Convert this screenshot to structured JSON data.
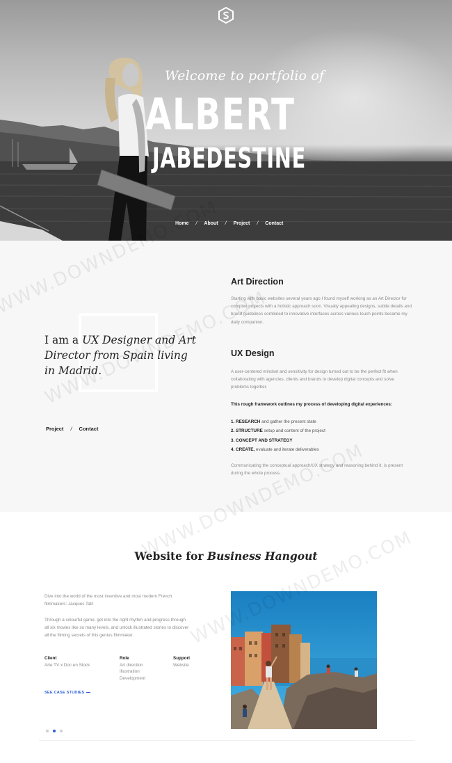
{
  "hero": {
    "logo_icon": "hexagon-s-logo-icon",
    "welcome": "Welcome to portfolio of",
    "first_name": "ALBERT",
    "last_name": "JABEDESTINE",
    "nav": [
      "Home",
      "About",
      "Project",
      "Contact"
    ],
    "nav_separator": "/"
  },
  "about": {
    "tagline_plain": "I am a",
    "tagline_italic": "UX Designer and Art Director from Spain living in Madrid.",
    "links": [
      "Project",
      "Contact"
    ],
    "links_separator": "/",
    "art_direction": {
      "title": "Art Direction",
      "text": "Starting with basic websites several years ago I found myself working as an Art Director for complex projects with a holistic approach soon. Visually appealing designs, subtle details and brand guidelines combined to innovative interfaces across various touch points became my daily companion."
    },
    "ux_design": {
      "title": "UX Design",
      "text": "A user-centered mindset and sensitivity for design turned out to be the perfect fit when collaborating with agencies, clients and brands to develop digital concepts and solve problems together.",
      "framework_intro": "This rough framework outlines my process of developing digital experiences:",
      "steps": [
        {
          "num": "1.",
          "bold": "RESEARCH",
          "rest": " and gather the present state"
        },
        {
          "num": "2.",
          "bold": "STRUCTURE",
          "rest": " setup and content of the project"
        },
        {
          "num": "3.",
          "bold": "CONCEPT AND STRATEGY",
          "rest": ""
        },
        {
          "num": "4.",
          "bold": "CREATE,",
          "rest": " evaluate and iterate deliverables"
        }
      ],
      "closing": "Communicating the conceptual approach/UX strategy and reasoning behind it, is present during the whole process."
    }
  },
  "project": {
    "title_plain": "Website for",
    "title_italic": "Business Hangout",
    "desc1": "Dive into the world of the most inventive and most modern French filmmakers: Jacques Tati!",
    "desc2": "Through a colourful game, get into the right rhythm and progress through all six movies like so many levels, and unlock illustrated stories to discover all the filming secrets of this genius filmmaker.",
    "client": {
      "label": "Client",
      "lines": [
        "Arte TV x Doc en Stock"
      ]
    },
    "role": {
      "label": "Role",
      "lines": [
        "Art direction",
        "Illustration",
        "Development"
      ]
    },
    "support": {
      "label": "Support",
      "lines": [
        "Website"
      ]
    },
    "cta": "SEE CASE STUDIES",
    "slider_dots": 3,
    "active_dot": 1
  },
  "watermark": "WWW.DOWNDEMO.COM",
  "colors": {
    "accent": "#2a5bd7",
    "about_bg": "#f7f7f7",
    "text_dark": "#222222",
    "text_muted": "#8a8a8a"
  }
}
